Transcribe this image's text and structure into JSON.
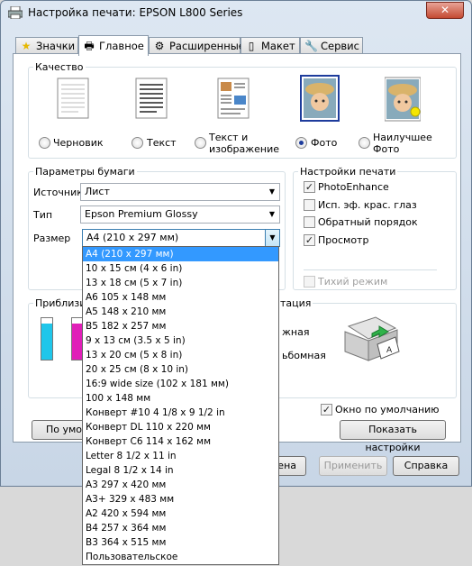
{
  "window": {
    "title": "Настройка печати: EPSON L800 Series",
    "close": "✕"
  },
  "tabs": [
    {
      "label": "Значки",
      "icon": "star-icon"
    },
    {
      "label": "Главное",
      "icon": "printer-icon"
    },
    {
      "label": "Расширенные",
      "icon": "gear-icon"
    },
    {
      "label": "Макет",
      "icon": "layout-icon"
    },
    {
      "label": "Сервис",
      "icon": "wrench-icon"
    }
  ],
  "quality": {
    "label": "Качество",
    "options": [
      {
        "label": "Черновик",
        "selected": false
      },
      {
        "label": "Текст",
        "selected": false
      },
      {
        "label": "Текст и изображение",
        "selected": false
      },
      {
        "label": "Фото",
        "selected": true
      },
      {
        "label": "Наилучшее Фото",
        "selected": false
      }
    ]
  },
  "paper": {
    "label": "Параметры бумаги",
    "source_label": "Источник",
    "source_value": "Лист",
    "type_label": "Тип",
    "type_value": "Epson Premium Glossy",
    "size_label": "Размер",
    "size_value": "A4 (210 x 297 мм)"
  },
  "print_settings": {
    "label": "Настройки печати",
    "options": [
      {
        "label": "PhotoEnhance",
        "checked": true,
        "disabled": false
      },
      {
        "label": "Исп. эф. крас. глаз",
        "checked": false,
        "disabled": false
      },
      {
        "label": "Обратный порядок",
        "checked": false,
        "disabled": false
      },
      {
        "label": "Просмотр",
        "checked": true,
        "disabled": false
      }
    ],
    "quiet": {
      "label": "Тихий режим",
      "checked": false,
      "disabled": true
    }
  },
  "ink": {
    "label": "Приблизит",
    "colors": [
      "#1fc6ea",
      "#e020b8"
    ]
  },
  "orientation": {
    "label": "тация",
    "portrait": "жная",
    "landscape": "ьбомная"
  },
  "default_checkbox": {
    "label": "Окно по умолчанию",
    "checked": true
  },
  "buttons": {
    "defaults": "По умол",
    "show_settings": "Показать настройки",
    "cancel": "лена",
    "apply": "Применить",
    "help": "Справка"
  },
  "size_dropdown": [
    "A4 (210 x 297 мм)",
    "10 x 15 см (4 x 6 in)",
    "13 x 18 см (5 x 7 in)",
    "A6 105 x 148 мм",
    "A5 148 x 210 мм",
    "B5 182 x 257 мм",
    "9 x 13 см (3.5 x 5 in)",
    "13 x 20 см (5 x 8 in)",
    "20 x 25 см (8 x 10 in)",
    "16:9 wide size (102 x 181 мм)",
    "100 x 148 мм",
    "Конверт #10 4 1/8 x 9 1/2 in",
    "Конверт DL  110 x 220 мм",
    "Конверт C6  114 x 162 мм",
    "Letter 8 1/2 x 11 in",
    "Legal 8 1/2 x 14 in",
    "A3 297 x 420 мм",
    "A3+ 329 x 483 мм",
    "A2 420 x 594 мм",
    "B4 257 x 364 мм",
    "B3 364 x 515 мм",
    "Пользовательское"
  ],
  "size_dropdown_selected": 0
}
